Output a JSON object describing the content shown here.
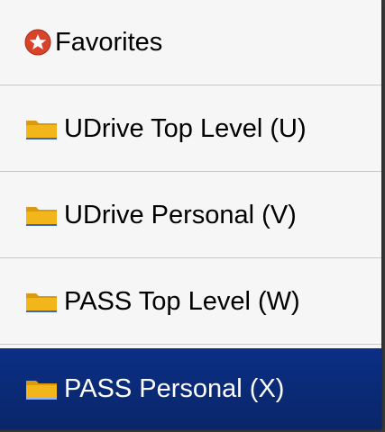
{
  "menu": {
    "items": [
      {
        "label": "Favorites",
        "icon": "star-badge-icon",
        "selected": false
      },
      {
        "label": "UDrive Top Level (U)",
        "icon": "folder-icon",
        "selected": false
      },
      {
        "label": "UDrive Personal (V)",
        "icon": "folder-icon",
        "selected": false
      },
      {
        "label": "PASS Top Level (W)",
        "icon": "folder-icon",
        "selected": false
      },
      {
        "label": "PASS Personal (X)",
        "icon": "folder-icon",
        "selected": true
      }
    ]
  },
  "colors": {
    "selected_background": "#0b2f86",
    "favorites_icon": "#d8432b",
    "folder_icon": "#f2b51a"
  }
}
